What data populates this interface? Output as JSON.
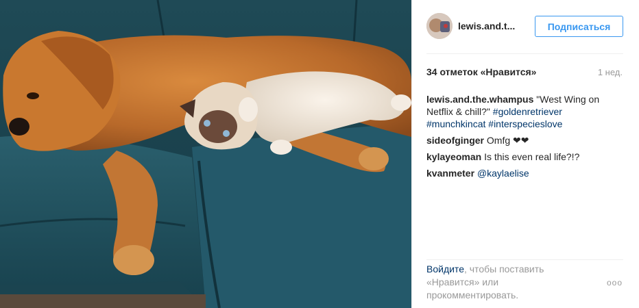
{
  "post": {
    "username": "lewis.and.t...",
    "follow_label": "Подписаться",
    "likes_text": "34 отметок «Нравится»",
    "time_ago": "1 нед.",
    "comments": [
      {
        "author": "lewis.and.the.whampus",
        "parts": [
          {
            "text": "\"West Wing on Netflix & chill?\" "
          },
          {
            "text": "#goldenretriever",
            "tag": true
          },
          {
            "text": " "
          },
          {
            "text": "#munchkincat",
            "tag": true
          },
          {
            "text": " "
          },
          {
            "text": "#interspecieslove",
            "tag": true
          }
        ]
      },
      {
        "author": "sideofginger",
        "parts": [
          {
            "text": "Omfg "
          },
          {
            "text": "❤❤",
            "emoji": true
          }
        ]
      },
      {
        "author": "kylayeoman",
        "parts": [
          {
            "text": "Is this even real life?!?"
          }
        ]
      },
      {
        "author": "kvanmeter",
        "parts": [
          {
            "text": "@kaylaelise",
            "tag": true
          }
        ]
      }
    ],
    "footer": {
      "login_link": "Войдите",
      "rest": ", чтобы поставить «Нравится» или прокомментировать."
    },
    "more_icon": "ellipsis-icon",
    "more_glyph": "ooo"
  },
  "colors": {
    "accent": "#3897f0",
    "link": "#003569",
    "muted": "#999999",
    "text": "#262626"
  }
}
